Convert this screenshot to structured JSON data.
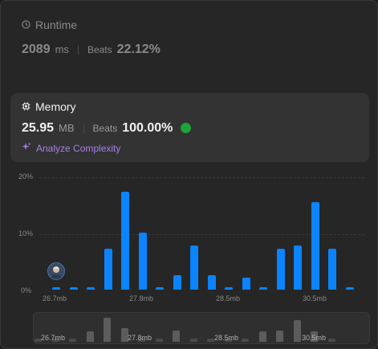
{
  "runtime": {
    "title": "Runtime",
    "value": "2089",
    "unit": "ms",
    "beats_label": "Beats",
    "beats_value": "22.12%"
  },
  "memory": {
    "title": "Memory",
    "value": "25.95",
    "unit": "MB",
    "beats_label": "Beats",
    "beats_value": "100.00%",
    "analyze_label": "Analyze Complexity"
  },
  "colors": {
    "bar": "#0a84ff",
    "analyze": "#a87ee8",
    "badge": "#1fa33a"
  },
  "chart_data": {
    "type": "bar",
    "y_ticks": [
      "20%",
      "10%",
      "0%"
    ],
    "ylim": [
      0,
      20
    ],
    "x_ticks": [
      "26.7mb",
      "27.8mb",
      "28.5mb",
      "30.5mb"
    ],
    "values": [
      0.5,
      0.5,
      0.5,
      7.3,
      17.5,
      10.2,
      0.5,
      2.6,
      7.9,
      2.6,
      0.5,
      2.1,
      0.5,
      7.3,
      7.9,
      15.6,
      7.3,
      0.5
    ],
    "highlight_index": 0
  },
  "navigator": {
    "x_ticks": [
      "26.7mb",
      "27.8mb",
      "28.5mb",
      "30.5mb"
    ]
  }
}
